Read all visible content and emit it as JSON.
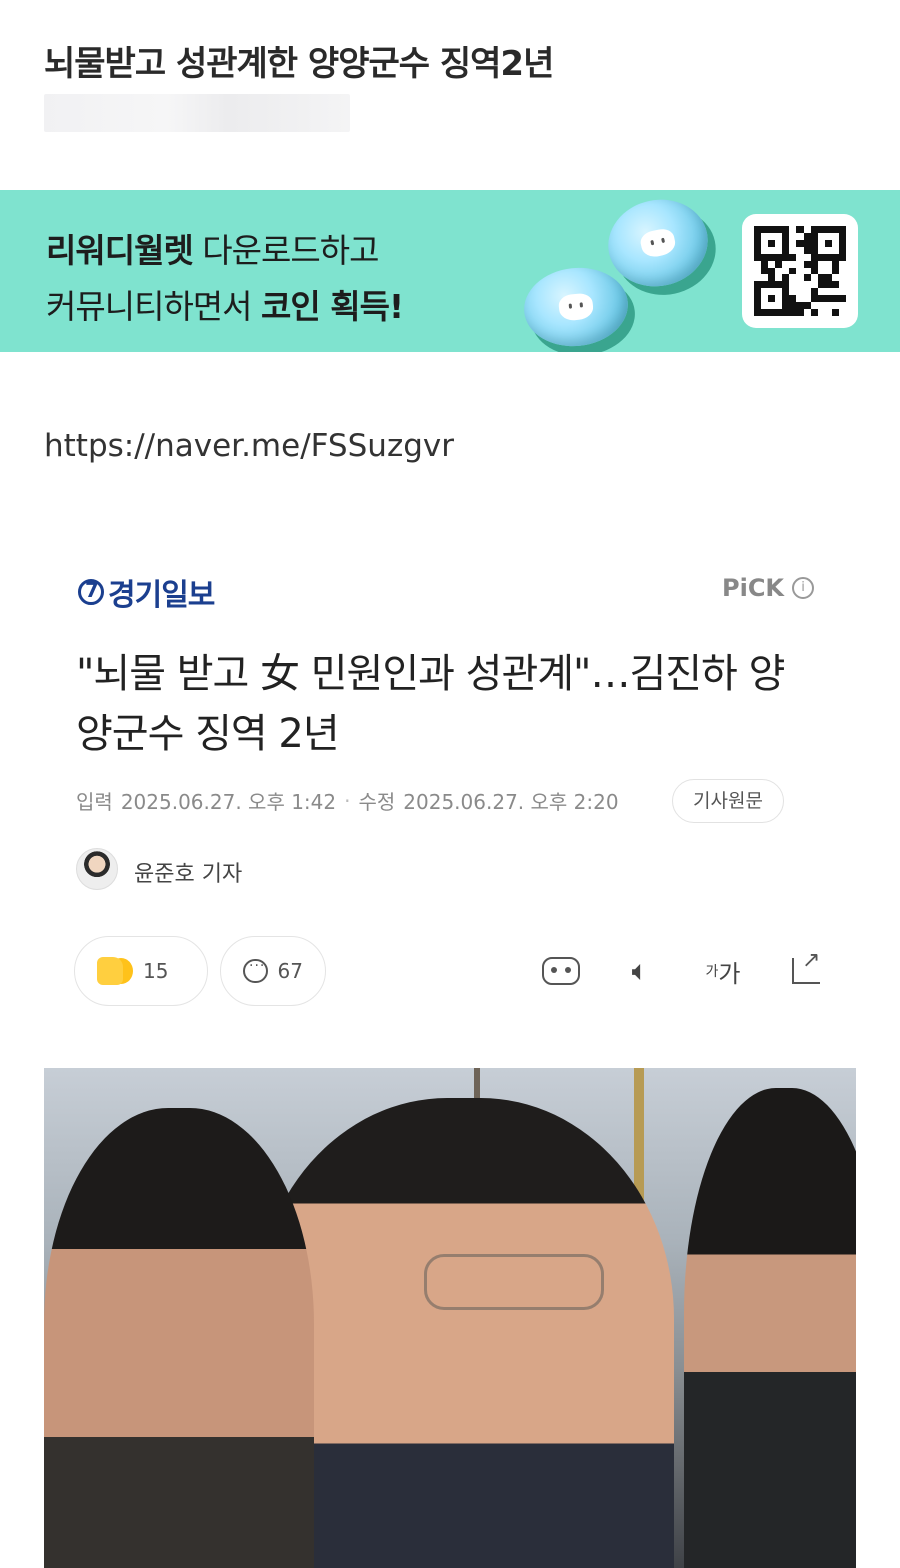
{
  "post": {
    "title": "뇌물받고 성관계한 양양군수 징역2년"
  },
  "banner": {
    "line1_bold": "리워디월렛",
    "line1_rest": " 다운로드하고",
    "line2_rest": "커뮤니티하면서 ",
    "line2_bold": "코인 획득!",
    "bg_color": "#7fe3cf"
  },
  "link": {
    "url": "https://naver.me/FSSuzgvr"
  },
  "article": {
    "publisher": "경기일보",
    "pick_label": "PiCK",
    "headline": "\"뇌물 받고 女 민원인과 성관계\"…김진하 양양군수 징역 2년",
    "input_label": "입력",
    "input_time": "2025.06.27. 오후 1:42",
    "edit_label": "수정",
    "edit_time": "2025.06.27. 오후 2:20",
    "original_button": "기사원문",
    "reporter": "윤준호 기자",
    "like_count": "15",
    "comment_count": "67",
    "font_size_label_small": "가",
    "font_size_label_large": "가",
    "brand_color": "#1b3f8f"
  },
  "icons": {
    "info": "info-icon",
    "robot": "robot-summary-icon",
    "speaker": "speaker-icon",
    "share": "share-icon",
    "comment": "comment-bubble-icon",
    "like": "thumbs-up-icon"
  }
}
